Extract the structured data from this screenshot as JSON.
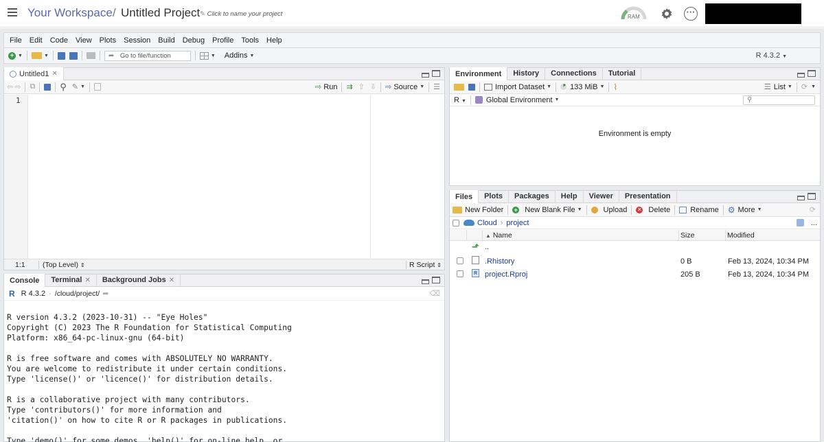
{
  "header": {
    "workspace": "Your Workspace",
    "separator": "/",
    "project": "Untitled Project",
    "rename_hint": "Click to name your project",
    "ram_label": "RAM"
  },
  "menu": [
    "File",
    "Edit",
    "Code",
    "View",
    "Plots",
    "Session",
    "Build",
    "Debug",
    "Profile",
    "Tools",
    "Help"
  ],
  "toolbar": {
    "goto_placeholder": "Go to file/function",
    "addins": "Addins",
    "r_version": "R 4.3.2"
  },
  "editor": {
    "tab": "Untitled1",
    "run": "Run",
    "source": "Source",
    "line_number": "1",
    "cursor_pos": "1:1",
    "scope": "(Top Level)",
    "file_type": "R Script"
  },
  "console": {
    "tabs": [
      "Console",
      "Terminal",
      "Background Jobs"
    ],
    "r_version": "R 4.3.2",
    "dot": "·",
    "path": "/cloud/project/",
    "output": "R version 4.3.2 (2023-10-31) -- \"Eye Holes\"\nCopyright (C) 2023 The R Foundation for Statistical Computing\nPlatform: x86_64-pc-linux-gnu (64-bit)\n\nR is free software and comes with ABSOLUTELY NO WARRANTY.\nYou are welcome to redistribute it under certain conditions.\nType 'license()' or 'licence()' for distribution details.\n\nR is a collaborative project with many contributors.\nType 'contributors()' for more information and\n'citation()' on how to cite R or R packages in publications.\n\nType 'demo()' for some demos, 'help()' for on-line help, or"
  },
  "environment": {
    "tabs": [
      "Environment",
      "History",
      "Connections",
      "Tutorial"
    ],
    "import_dataset": "Import Dataset",
    "memory": "133 MiB",
    "view_mode": "List",
    "language": "R",
    "scope": "Global Environment",
    "empty_message": "Environment is empty"
  },
  "files": {
    "tabs": [
      "Files",
      "Plots",
      "Packages",
      "Help",
      "Viewer",
      "Presentation"
    ],
    "new_folder": "New Folder",
    "new_blank_file": "New Blank File",
    "upload": "Upload",
    "delete": "Delete",
    "rename": "Rename",
    "more": "More",
    "breadcrumb": [
      "Cloud",
      "project"
    ],
    "overflow": "...",
    "columns": {
      "name": "Name",
      "size": "Size",
      "modified": "Modified"
    },
    "up_label": "..",
    "rows": [
      {
        "name": ".Rhistory",
        "size": "0 B",
        "modified": "Feb 13, 2024, 10:34 PM"
      },
      {
        "name": "project.Rproj",
        "size": "205 B",
        "modified": "Feb 13, 2024, 10:34 PM"
      }
    ]
  },
  "colors": {
    "accent": "#5a6aa8",
    "link": "#1a3d9a",
    "pane_border": "#cfd2d6"
  }
}
